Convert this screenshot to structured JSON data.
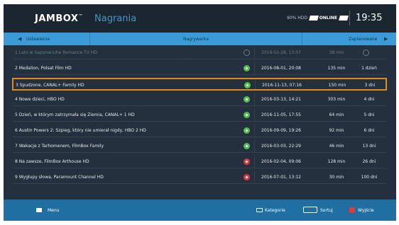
{
  "header": {
    "logo": "JAMBOX",
    "logo_mark": "™",
    "section_title": "Nagrania",
    "status_left": "90% HDD",
    "status_right": "ONLINE",
    "clock": "19:35"
  },
  "tabs": {
    "left": "Ustawienia",
    "middle": "Nagrywarka",
    "right": "Zaplanowane"
  },
  "recordings": [
    {
      "title": "1 Lato w Saponariuhe Romance TV HD",
      "status": "ring",
      "date": "2016-02-28, 13:07",
      "duration": "38 min",
      "age": "",
      "dim": true,
      "selected": false
    },
    {
      "title": "2 Medalion, Polsat Film HD",
      "status": "green",
      "date": "2016-08-01, 20:08",
      "duration": "135 min",
      "age": "1 dzień",
      "dim": false,
      "selected": false
    },
    {
      "title": "3 Spudzone, CANAL+ Family HD",
      "status": "green",
      "date": "2016-11-13, 07:16",
      "duration": "150 min",
      "age": "3 dni",
      "dim": false,
      "selected": true
    },
    {
      "title": "4 Nowe dzieci, HBO HD",
      "status": "green",
      "date": "2016-03-13, 14:21",
      "duration": "303 min",
      "age": "4 dni",
      "dim": false,
      "selected": false
    },
    {
      "title": "5 Dzień, w którym zatrzymała się Ziemia, CANAL+ 1 HD",
      "status": "green",
      "date": "2016-11-05, 17:55",
      "duration": "64 min",
      "age": "5 dni",
      "dim": false,
      "selected": false
    },
    {
      "title": "6 Austin Powers 2: Szpieg, który nie umierał nigdy, HBO 2 HD",
      "status": "green",
      "date": "2016-09-09, 19:26",
      "duration": "92 min",
      "age": "6 dni",
      "dim": false,
      "selected": false
    },
    {
      "title": "7 Wakacje z Tarhomenem, FilmBox Family",
      "status": "green",
      "date": "2016-03-03, 22:29",
      "duration": "46 min",
      "age": "13 dni",
      "dim": false,
      "selected": false
    },
    {
      "title": "8 Na zawsze, FilmBox Arthouse HD",
      "status": "red",
      "date": "2016-02-04, 09:06",
      "duration": "128 min",
      "age": "26 dni",
      "dim": false,
      "selected": false
    },
    {
      "title": "9 Wygłupy słowa, Paramount Channel HD",
      "status": "red",
      "date": "2016-07-01, 13:12",
      "duration": "30 min",
      "age": "100 dni",
      "dim": false,
      "selected": false
    }
  ],
  "footer": {
    "menu_label": "Menu",
    "category_label": "Kategorie",
    "sort_label": "Sortuj",
    "delete_label": "Wyjście"
  },
  "colors": {
    "accent": "#3b9bd6",
    "selection": "#e08a1c",
    "ok": "#4cc24a",
    "error": "#e2393a",
    "background": "#24303d"
  }
}
